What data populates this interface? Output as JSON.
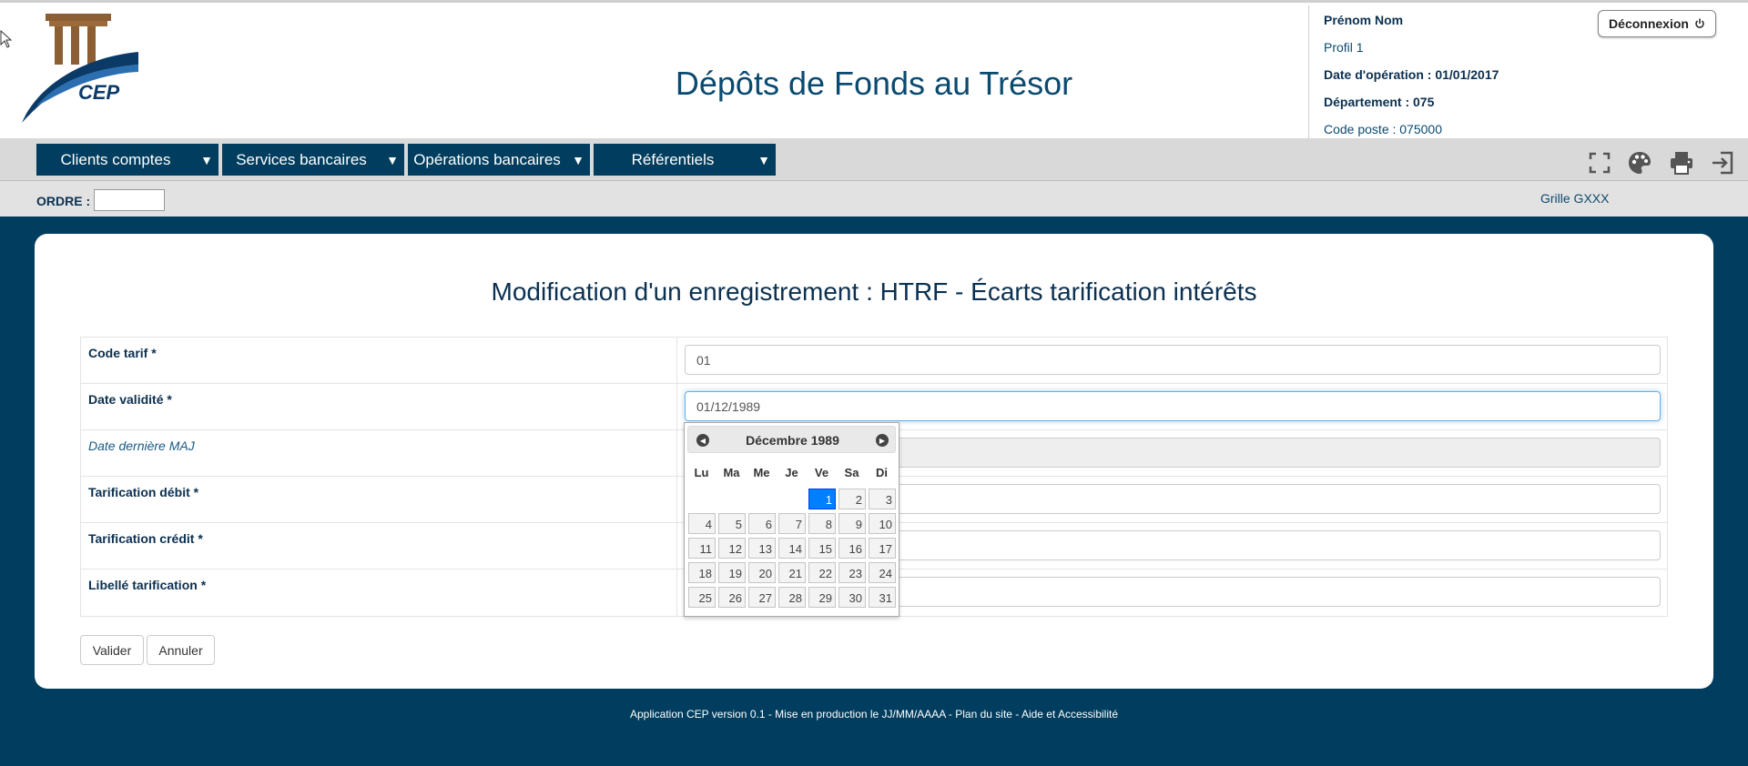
{
  "header": {
    "logo_text": "CEP",
    "app_title": "Dépôts de Fonds au Trésor",
    "user": {
      "name": "Prénom Nom",
      "profile": "Profil 1",
      "operation_date": "Date d'opération : 01/01/2017",
      "department": "Département : 075",
      "post_code": "Code poste : 075000"
    },
    "logout_label": "Déconnexion",
    "logout_icon": "power-icon"
  },
  "menu": {
    "items": [
      {
        "label": "Clients comptes"
      },
      {
        "label": "Services bancaires"
      },
      {
        "label": "Opérations bancaires"
      },
      {
        "label": "Référentiels"
      }
    ],
    "tools": [
      "fullscreen-icon",
      "palette-icon",
      "print-icon",
      "exit-icon"
    ]
  },
  "orderbar": {
    "order_label": "ORDRE :",
    "order_value": "",
    "grid_label": "Grille GXXX"
  },
  "form": {
    "title": "Modification d'un enregistrement : HTRF - Écarts tarification intérêts",
    "fields": [
      {
        "label": "Code tarif *",
        "value": ""
      },
      {
        "label": "Date validité *",
        "value": ""
      },
      {
        "label": "Date dernière MAJ",
        "value": ""
      },
      {
        "label": "Tarification débit *",
        "value": ""
      },
      {
        "label": "Tarification crédit *",
        "value": ""
      },
      {
        "label": "Libellé tarification *",
        "value": ""
      }
    ],
    "code_tarif_value": "01",
    "date_validite_value": "01/12/1989",
    "submit_label": "Valider",
    "cancel_label": "Annuler"
  },
  "datepicker": {
    "title": "Décembre 1989",
    "weekdays": [
      "Lu",
      "Ma",
      "Me",
      "Je",
      "Ve",
      "Sa",
      "Di"
    ],
    "selected_day": 1,
    "weeks": [
      [
        "",
        "",
        "",
        "",
        "1",
        "2",
        "3"
      ],
      [
        "4",
        "5",
        "6",
        "7",
        "8",
        "9",
        "10"
      ],
      [
        "11",
        "12",
        "13",
        "14",
        "15",
        "16",
        "17"
      ],
      [
        "18",
        "19",
        "20",
        "21",
        "22",
        "23",
        "24"
      ],
      [
        "25",
        "26",
        "27",
        "28",
        "29",
        "30",
        "31"
      ]
    ]
  },
  "footer": {
    "text": "Application CEP version 0.1 - Mise en production le JJ/MM/AAAA - Plan du site - Aide et Accessibilité"
  },
  "colors": {
    "brand_dark": "#003d5e",
    "title_blue": "#0b4a70",
    "logo_brown": "#8b5e34",
    "selected_day": "#007fff"
  }
}
